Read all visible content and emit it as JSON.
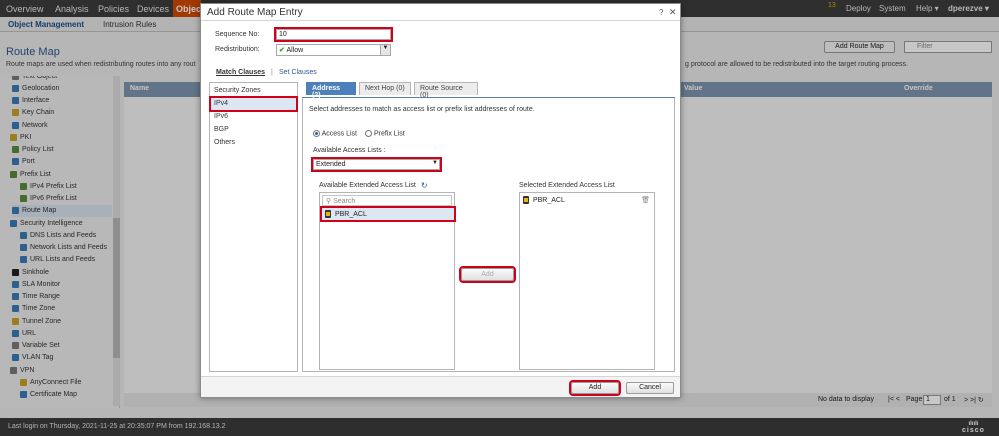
{
  "topnav": {
    "items": [
      "Overview",
      "Analysis",
      "Policies",
      "Devices",
      "Objects"
    ],
    "right_items": [
      "Deploy",
      "System",
      "Help ▾",
      "dperezve ▾"
    ],
    "alert_count": "13"
  },
  "subnav": {
    "tabs": [
      "Object Management",
      "Intrusion Rules"
    ]
  },
  "page": {
    "title": "Route Map",
    "description": "Route maps are used when redistributing routes into any rout",
    "description_right": "g protocol are allowed to be redistributed into the target routing process.",
    "add_button": "Add Route Map",
    "filter_placeholder": "Filter",
    "columns": [
      "Name",
      "Value",
      "Override"
    ],
    "no_data": "No data to display",
    "page_label": "Page",
    "page_value": "1",
    "of_label": "of 1"
  },
  "tree": {
    "items": [
      {
        "label": "Text Object",
        "color": "#7a7a7a"
      },
      {
        "label": "Geolocation",
        "color": "#3a7ab8"
      },
      {
        "label": "Interface",
        "color": "#3a7ab8"
      },
      {
        "label": "Key Chain",
        "color": "#c9a227"
      },
      {
        "label": "Network",
        "color": "#3a7ab8"
      },
      {
        "label": "PKI",
        "color": "#c9a227"
      },
      {
        "label": "Policy List",
        "color": "#5a8a3a"
      },
      {
        "label": "Port",
        "color": "#3a7ab8"
      },
      {
        "label": "Prefix List",
        "color": "#5a8a3a"
      },
      {
        "label": "IPv4 Prefix List",
        "color": "#5a8a3a"
      },
      {
        "label": "IPv6 Prefix List",
        "color": "#5a8a3a"
      },
      {
        "label": "Route Map",
        "color": "#3a7ab8"
      },
      {
        "label": "Security Intelligence",
        "color": "#3a7ab8"
      },
      {
        "label": "DNS Lists and Feeds",
        "color": "#3a7ab8"
      },
      {
        "label": "Network Lists and Feeds",
        "color": "#3a7ab8"
      },
      {
        "label": "URL Lists and Feeds",
        "color": "#3a7ab8"
      },
      {
        "label": "Sinkhole",
        "color": "#222222"
      },
      {
        "label": "SLA Monitor",
        "color": "#3a7ab8"
      },
      {
        "label": "Time Range",
        "color": "#3a7ab8"
      },
      {
        "label": "Time Zone",
        "color": "#3a7ab8"
      },
      {
        "label": "Tunnel Zone",
        "color": "#c9a227"
      },
      {
        "label": "URL",
        "color": "#3a7ab8"
      },
      {
        "label": "Variable Set",
        "color": "#7a7a7a"
      },
      {
        "label": "VLAN Tag",
        "color": "#3a7ab8"
      },
      {
        "label": "VPN",
        "color": "#7a7a7a"
      },
      {
        "label": "AnyConnect File",
        "color": "#c9a227"
      },
      {
        "label": "Certificate Map",
        "color": "#3a7ab8"
      }
    ]
  },
  "status": {
    "last_login": "Last login on Thursday, 2021-11-25 at 20:35:07 PM from 192.168.13.2",
    "logo": "cisco"
  },
  "modal": {
    "title": "Add Route Map Entry",
    "help": "?",
    "close": "✕",
    "sequence_label": "Sequence No:",
    "sequence_value": "10",
    "redistribution_label": "Redistribution:",
    "redistribution_value": "Allow",
    "match_tab": "Match Clauses",
    "set_tab": "Set Clauses",
    "match_items": [
      "Security Zones",
      "IPv4",
      "IPv6",
      "BGP",
      "Others"
    ],
    "tabs": [
      "Address (2)",
      "Next Hop (0)",
      "Route Source (0)"
    ],
    "instruction": "Select addresses to match as access list or prefix list addresses of route.",
    "radio_access": "Access List",
    "radio_prefix": "Prefix List",
    "available_lists_label": "Available Access Lists :",
    "available_lists_value": "Extended",
    "available_ext_label": "Available Extended Access List",
    "search_placeholder": "Search",
    "available_item": "PBR_ACL",
    "add_middle": "Add",
    "selected_ext_label": "Selected Extended Access List",
    "selected_item": "PBR_ACL",
    "add_button": "Add",
    "cancel_button": "Cancel"
  },
  "accent": "#d0021b"
}
